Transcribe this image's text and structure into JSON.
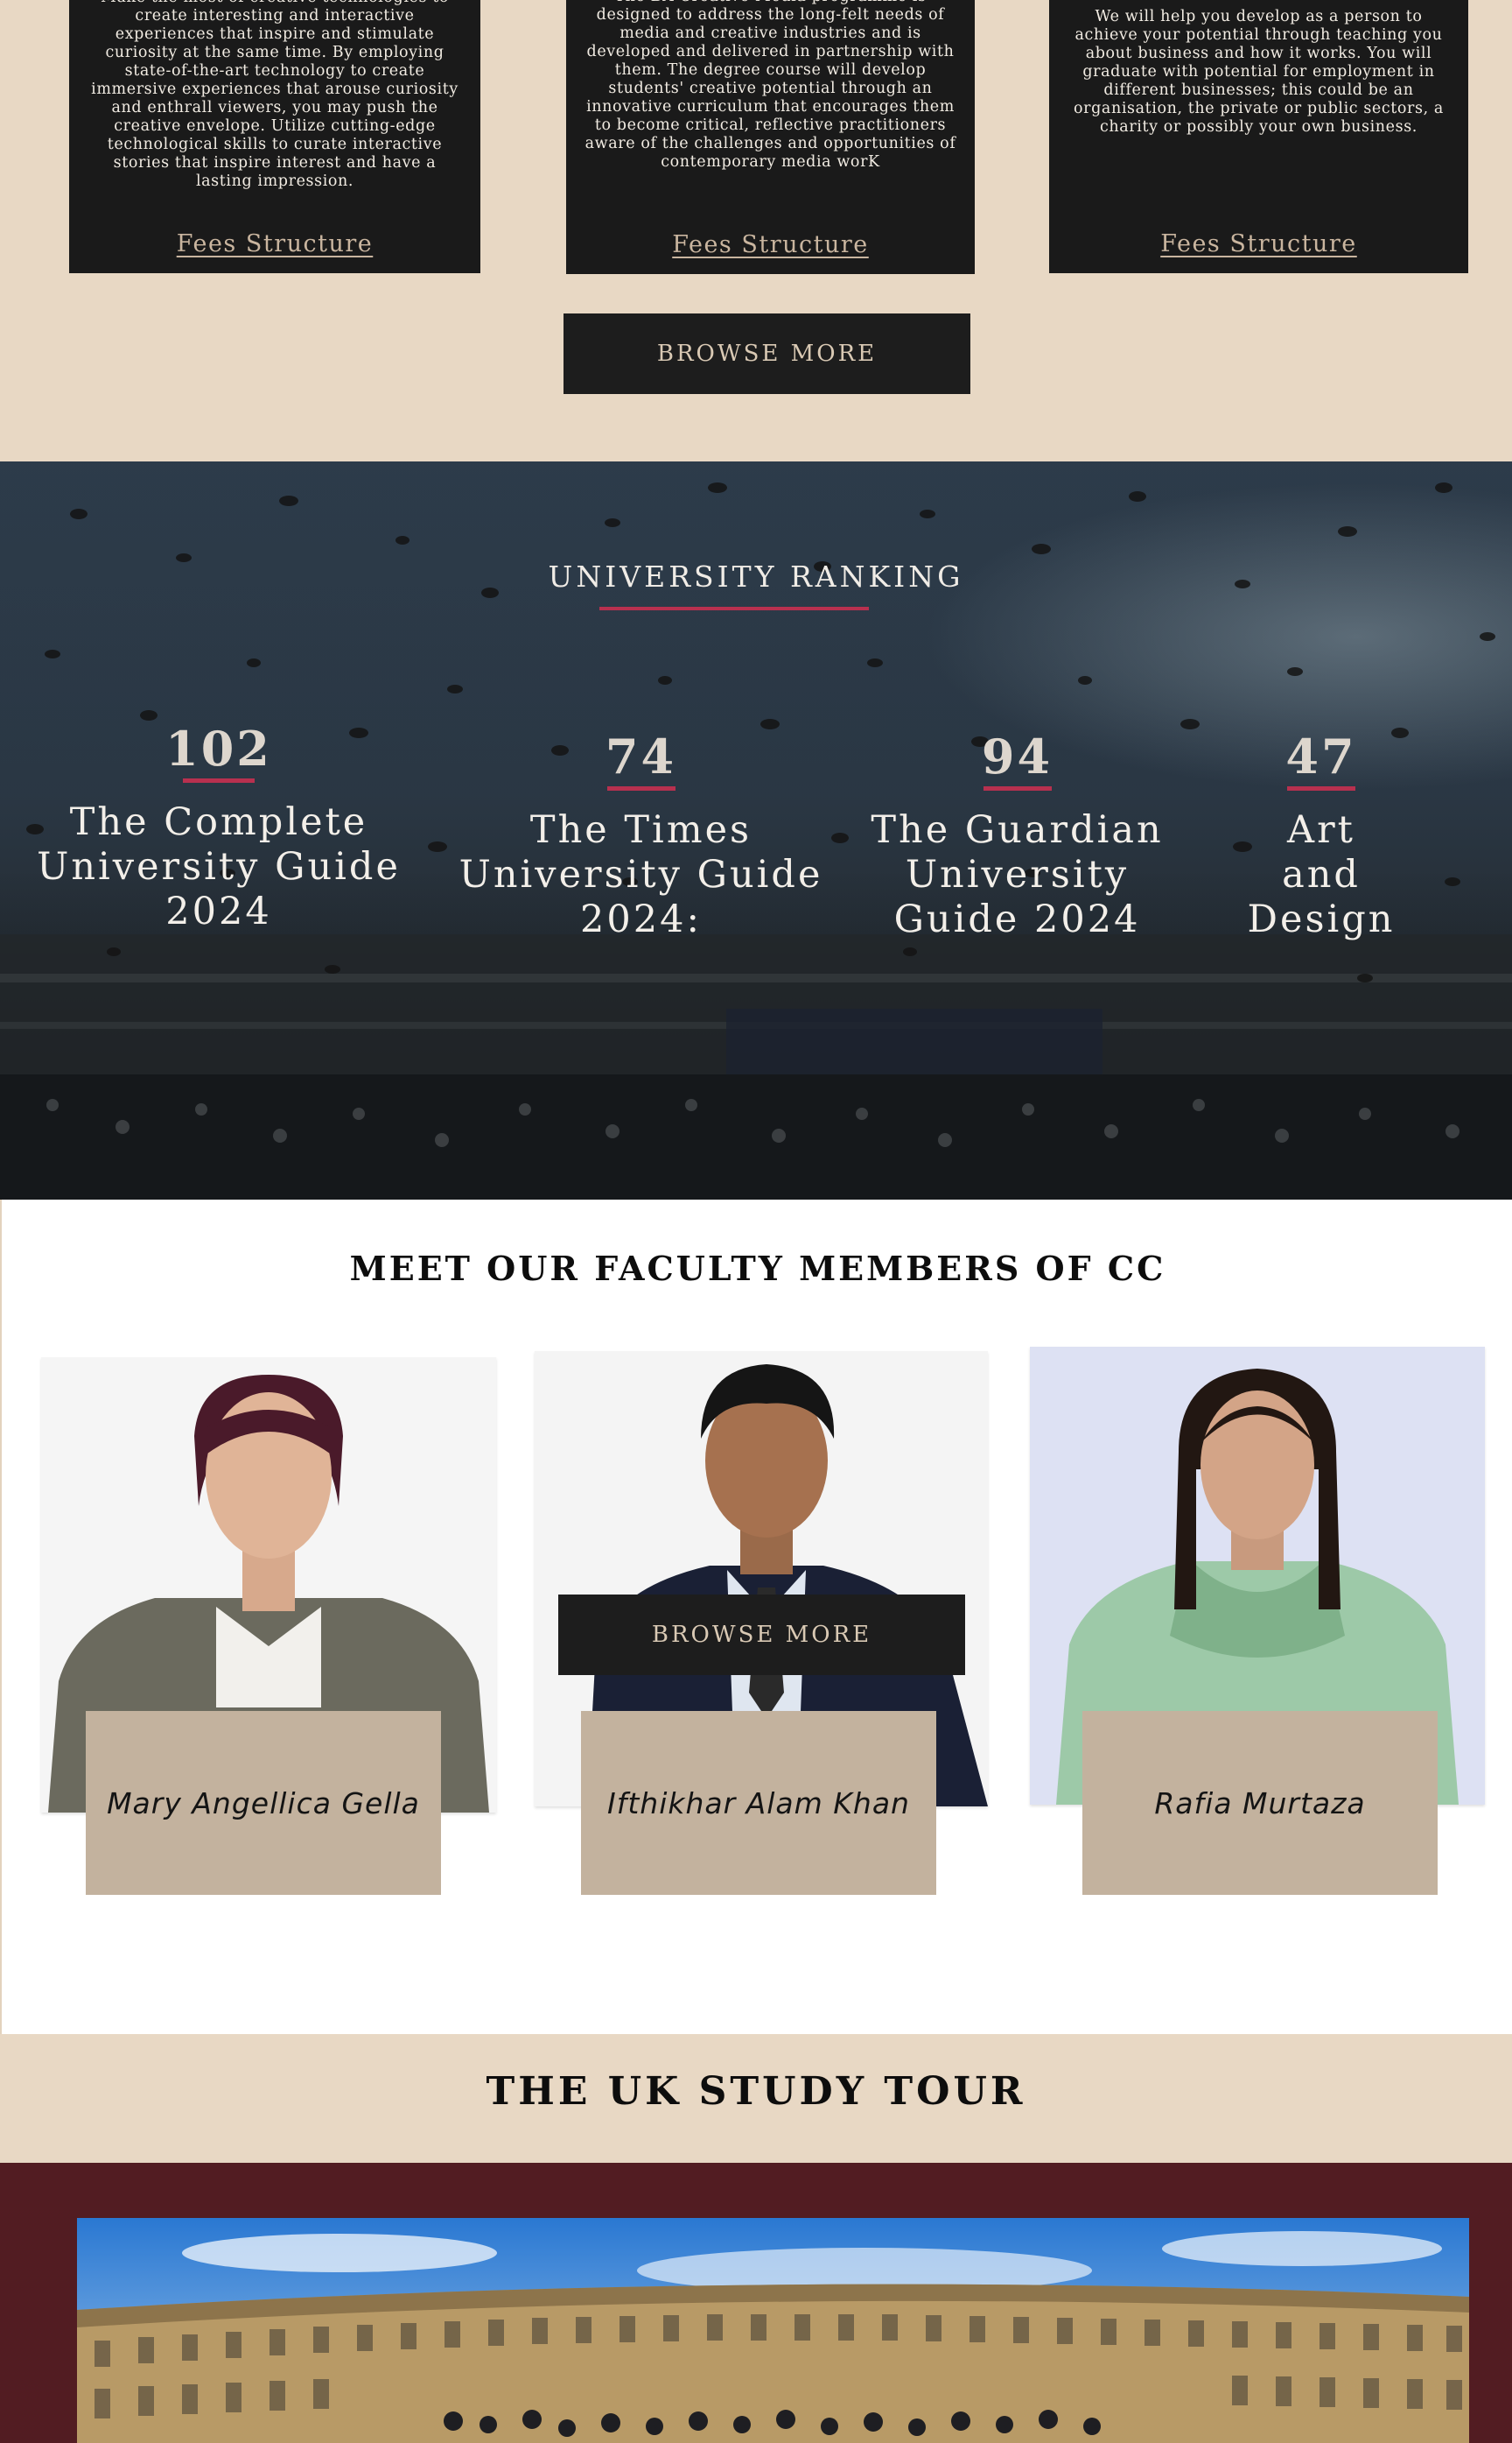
{
  "courses": {
    "cards": [
      {
        "text": "Make the most of creative technologies to create interesting and interactive experiences that inspire and stimulate curiosity at the same time. By employing state-of-the-art technology to create immersive experiences that arouse curiosity and enthrall viewers, you may push the creative envelope. Utilize cutting-edge technological skills to curate interactive stories that inspire interest and have a lasting impression.",
        "link": "Fees Structure"
      },
      {
        "text": "The BA Creative Media programme is designed to address the long-felt needs of media and creative industries and is developed and delivered in partnership with them. The degree course will develop students' creative potential through an innovative curriculum that encourages them to become critical, reflective practitioners aware of the challenges and opportunities of contemporary media worK",
        "link": "Fees Structure"
      },
      {
        "text": "We will help you develop as a person to achieve your potential through teaching you about business and how it works. You will graduate with potential for employment in different businesses; this could be an organisation, the private or public sectors, a charity or possibly your own business.",
        "link": "Fees Structure"
      }
    ],
    "browse_label": "BROWSE MORE"
  },
  "ranking": {
    "title": "UNIVERSITY RANKING",
    "items": [
      {
        "number": "102",
        "label": "The Complete University Guide 2024"
      },
      {
        "number": "74",
        "label": "The Times University Guide 2024:"
      },
      {
        "number": "94",
        "label": "The Guardian University Guide 2024"
      },
      {
        "number": "47",
        "label": "Art and Design"
      }
    ],
    "accent_color": "#b8304f"
  },
  "faculty": {
    "title": "MEET OUR FACULTY MEMBERS OF CC",
    "members": [
      {
        "name": "Mary Angellica Gella"
      },
      {
        "name": "Ifthikhar Alam Khan"
      },
      {
        "name": "Rafia Murtaza"
      }
    ],
    "browse_label": "BROWSE MORE"
  },
  "tour": {
    "title": "THE UK STUDY TOUR"
  }
}
